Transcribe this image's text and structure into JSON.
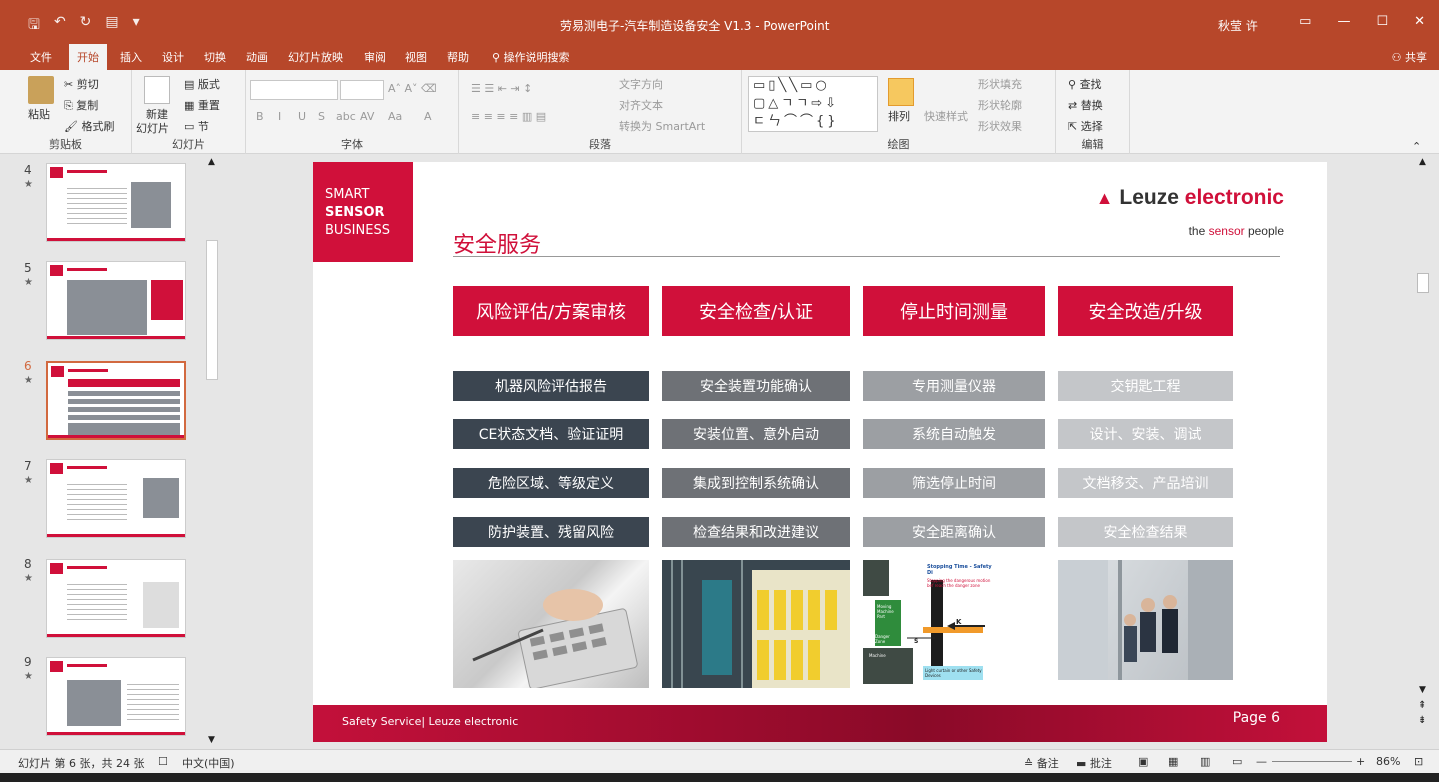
{
  "window": {
    "title": "劳易测电子-汽车制造设备安全 V1.3  -  PowerPoint",
    "user": "秋莹 许",
    "accent": "#b7472a"
  },
  "tabs": [
    "文件",
    "开始",
    "插入",
    "设计",
    "切换",
    "动画",
    "幻灯片放映",
    "审阅",
    "视图",
    "帮助",
    "操作说明搜索"
  ],
  "share_label": "共享",
  "ribbon": {
    "clipboard": {
      "paste": "粘贴",
      "cut": "剪切",
      "copy": "复制",
      "format_painter": "格式刷",
      "label": "剪贴板"
    },
    "slides": {
      "new_slide": "新建",
      "new_slide2": "幻灯片",
      "layout": "版式",
      "reset": "重置",
      "section": "节",
      "label": "幻灯片"
    },
    "font": {
      "label": "字体",
      "bold": "B",
      "italic": "I",
      "underline": "U",
      "shadow": "S",
      "strike": "abc",
      "spacing": "AV",
      "case": "Aa",
      "color": "A"
    },
    "paragraph": {
      "label": "段落",
      "text_direction": "文字方向",
      "align_text": "对齐文本",
      "smartart": "转换为 SmartArt"
    },
    "drawing": {
      "label": "绘图",
      "arrange": "排列",
      "quick_styles": "快速样式",
      "shape_fill": "形状填充",
      "shape_outline": "形状轮廓",
      "shape_effects": "形状效果"
    },
    "editing": {
      "label": "编辑",
      "find": "查找",
      "replace": "替换",
      "select": "选择"
    }
  },
  "thumbnails": [
    {
      "num": "4",
      "star": "★"
    },
    {
      "num": "5",
      "star": "★"
    },
    {
      "num": "6",
      "star": "★"
    },
    {
      "num": "7",
      "star": "★"
    },
    {
      "num": "8",
      "star": "★"
    },
    {
      "num": "9",
      "star": "★"
    }
  ],
  "slide": {
    "smart": "SMART",
    "sensor": "SENSOR",
    "business": "BUSINESS",
    "logo_a": "Leuze ",
    "logo_b": "electronic",
    "tagline_a": "the ",
    "tagline_b": "sensor",
    "tagline_c": " people",
    "title": "安全服务",
    "headers": [
      "风险评估/方案审核",
      "安全检查/认证",
      "停止时间测量",
      "安全改造/升级"
    ],
    "rows": [
      [
        "机器风险评估报告",
        "安全装置功能确认",
        "专用测量仪器",
        "交钥匙工程"
      ],
      [
        "CE状态文档、验证证明",
        "安装位置、意外启动",
        "系统自动触发",
        "设计、安装、调试"
      ],
      [
        "危险区域、等级定义",
        "集成到控制系统确认",
        "筛选停止时间",
        "文档移交、产品培训"
      ],
      [
        "防护装置、残留风险",
        "检查结果和改进建议",
        "安全距离确认",
        "安全检查结果"
      ]
    ],
    "diagram_title": "Stopping Time - Safety Di",
    "diagram_sub": "Stopping the dangerous motion bef reach the danger zone",
    "diagram_labels": {
      "k": "K",
      "s": "S",
      "danger": "Danger Zone",
      "machine": "Machine",
      "moving": "Moving Machine Part",
      "curtain": "Light curtain or other Safety Devices"
    },
    "footer": "Safety Service| Leuze electronic",
    "page": "Page 6"
  },
  "status": {
    "slide_info": "幻灯片 第 6 张，共 24 张",
    "language": "中文(中国)",
    "notes": "备注",
    "comments": "批注",
    "zoom": "86%"
  }
}
